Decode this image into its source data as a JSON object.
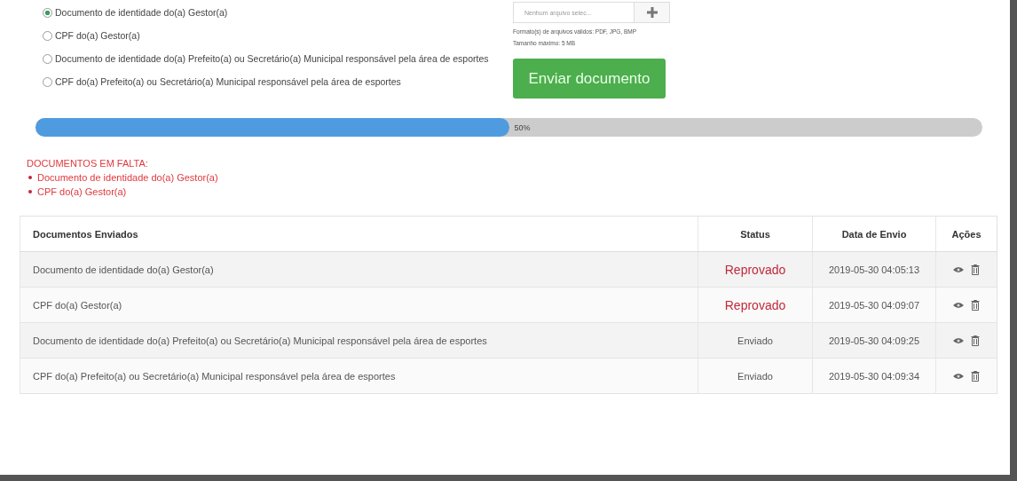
{
  "document_options": [
    {
      "label": "Documento de identidade do(a) Gestor(a)",
      "selected": true
    },
    {
      "label": "CPF do(a) Gestor(a)",
      "selected": false
    },
    {
      "label": "Documento de identidade do(a) Prefeito(a) ou Secretário(a) Municipal responsável pela área de esportes",
      "selected": false
    },
    {
      "label": "CPF do(a) Prefeito(a) ou Secretário(a) Municipal responsável pela área de esportes",
      "selected": false
    }
  ],
  "upload": {
    "file_placeholder": "Nenhum arquivo selec...",
    "formats": "Formato(s) de arquivos válidos: PDF, JPG, BMP",
    "max_size": "Tamanho máximo: 5 MB",
    "button": "Enviar documento"
  },
  "progress": {
    "level": 0.5,
    "label": "50%"
  },
  "missing": {
    "title": "DOCUMENTOS EM FALTA:",
    "items": [
      "Documento de identidade do(a) Gestor(a)",
      "CPF do(a) Gestor(a)"
    ]
  },
  "table": {
    "columns": [
      "Documentos Enviados",
      "Status",
      "Data de Envio",
      "Ações"
    ],
    "rows": [
      {
        "document": "Documento de identidade do(a) Gestor(a)",
        "status": "Reprovado",
        "kind": "rejected",
        "date": "2019-05-30 04:05:13"
      },
      {
        "document": "CPF do(a) Gestor(a)",
        "status": "Reprovado",
        "kind": "rejected",
        "date": "2019-05-30 04:09:07"
      },
      {
        "document": "Documento de identidade do(a) Prefeito(a) ou Secretário(a) Municipal responsável pela área de esportes",
        "status": "Enviado",
        "kind": "sent",
        "date": "2019-05-30 04:09:25"
      },
      {
        "document": "CPF do(a) Prefeito(a) ou Secretário(a) Municipal responsável pela área de esportes",
        "status": "Enviado",
        "kind": "sent",
        "date": "2019-05-30 04:09:34"
      }
    ]
  }
}
